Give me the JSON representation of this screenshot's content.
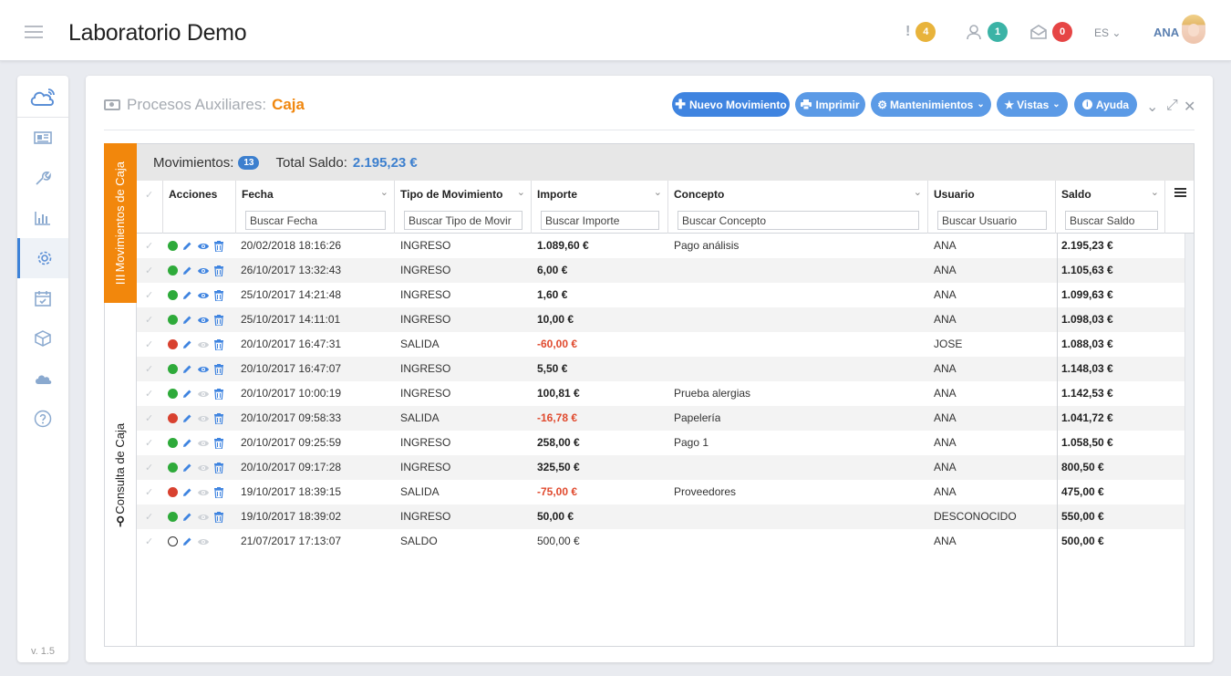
{
  "header": {
    "title": "Laboratorio Demo",
    "alerts_count": "4",
    "users_count": "1",
    "messages_count": "0",
    "language": "ES",
    "user": "ANA"
  },
  "colors": {
    "primary": "#3f84e0",
    "accent": "#f2870c",
    "status_in": "#2eaa3a",
    "status_out": "#d8412f",
    "negative": "#e04a2e"
  },
  "sidebar": {
    "items": [
      {
        "icon": "newspaper-icon"
      },
      {
        "icon": "wrench-icon"
      },
      {
        "icon": "bar-chart-icon"
      },
      {
        "icon": "gear-icon",
        "active": true
      },
      {
        "icon": "calendar-check-icon"
      },
      {
        "icon": "cube-icon"
      },
      {
        "icon": "cloud-icon"
      },
      {
        "icon": "help-icon"
      }
    ],
    "version": "v. 1.5"
  },
  "panel": {
    "title_prefix": "Procesos Auxiliares:",
    "title_accent": "Caja",
    "buttons": {
      "new": "Nuevo Movimiento",
      "print": "Imprimir",
      "maintenance": "Mantenimientos",
      "views": "Vistas",
      "help": "Ayuda"
    }
  },
  "tabs": {
    "movements": "Movimientos de Caja",
    "query": "Consulta de Caja"
  },
  "summary": {
    "movements_label": "Movimientos:",
    "movements_count": "13",
    "total_label": "Total Saldo:",
    "total_value": "2.195,23 €"
  },
  "columns": {
    "actions": "Acciones",
    "date": "Fecha",
    "type": "Tipo de Movimiento",
    "amount": "Importe",
    "concept": "Concepto",
    "user": "Usuario",
    "balance": "Saldo"
  },
  "filters": {
    "date": "Buscar Fecha",
    "type": "Buscar Tipo de Movir",
    "amount": "Buscar Importe",
    "concept": "Buscar Concepto",
    "user": "Buscar Usuario",
    "balance": "Buscar Saldo"
  },
  "rows": [
    {
      "status": "in",
      "view": true,
      "delete": true,
      "date": "20/02/2018 18:16:26",
      "type": "INGRESO",
      "amount": "1.089,60 €",
      "concept": "Pago análisis",
      "user": "ANA",
      "balance": "2.195,23 €"
    },
    {
      "status": "in",
      "view": true,
      "delete": true,
      "date": "26/10/2017 13:32:43",
      "type": "INGRESO",
      "amount": "6,00 €",
      "concept": "",
      "user": "ANA",
      "balance": "1.105,63 €"
    },
    {
      "status": "in",
      "view": true,
      "delete": true,
      "date": "25/10/2017 14:21:48",
      "type": "INGRESO",
      "amount": "1,60 €",
      "concept": "",
      "user": "ANA",
      "balance": "1.099,63 €"
    },
    {
      "status": "in",
      "view": true,
      "delete": true,
      "date": "25/10/2017 14:11:01",
      "type": "INGRESO",
      "amount": "10,00 €",
      "concept": "",
      "user": "ANA",
      "balance": "1.098,03 €"
    },
    {
      "status": "out",
      "view": false,
      "delete": true,
      "date": "20/10/2017 16:47:31",
      "type": "SALIDA",
      "amount": "-60,00 €",
      "concept": "",
      "user": "JOSE",
      "balance": "1.088,03 €"
    },
    {
      "status": "in",
      "view": true,
      "delete": true,
      "date": "20/10/2017 16:47:07",
      "type": "INGRESO",
      "amount": "5,50 €",
      "concept": "",
      "user": "ANA",
      "balance": "1.148,03 €"
    },
    {
      "status": "in",
      "view": false,
      "delete": true,
      "date": "20/10/2017 10:00:19",
      "type": "INGRESO",
      "amount": "100,81 €",
      "concept": "Prueba alergias",
      "user": "ANA",
      "balance": "1.142,53 €"
    },
    {
      "status": "out",
      "view": false,
      "delete": true,
      "date": "20/10/2017 09:58:33",
      "type": "SALIDA",
      "amount": "-16,78 €",
      "concept": "Papelería",
      "user": "ANA",
      "balance": "1.041,72 €"
    },
    {
      "status": "in",
      "view": false,
      "delete": true,
      "date": "20/10/2017 09:25:59",
      "type": "INGRESO",
      "amount": "258,00 €",
      "concept": "Pago 1",
      "user": "ANA",
      "balance": "1.058,50 €"
    },
    {
      "status": "in",
      "view": false,
      "delete": true,
      "date": "20/10/2017 09:17:28",
      "type": "INGRESO",
      "amount": "325,50 €",
      "concept": "",
      "user": "ANA",
      "balance": "800,50 €"
    },
    {
      "status": "out",
      "view": false,
      "delete": true,
      "date": "19/10/2017 18:39:15",
      "type": "SALIDA",
      "amount": "-75,00 €",
      "concept": "Proveedores",
      "user": "ANA",
      "balance": "475,00 €"
    },
    {
      "status": "in",
      "view": false,
      "delete": true,
      "date": "19/10/2017 18:39:02",
      "type": "INGRESO",
      "amount": "50,00 €",
      "concept": "",
      "user": "DESCONOCIDO",
      "balance": "550,00 €"
    },
    {
      "status": "open",
      "view": false,
      "delete": false,
      "date": "21/07/2017 17:13:07",
      "type": "SALDO",
      "amount": "500,00 €",
      "concept": "",
      "user": "ANA",
      "balance": "500,00 €"
    }
  ]
}
